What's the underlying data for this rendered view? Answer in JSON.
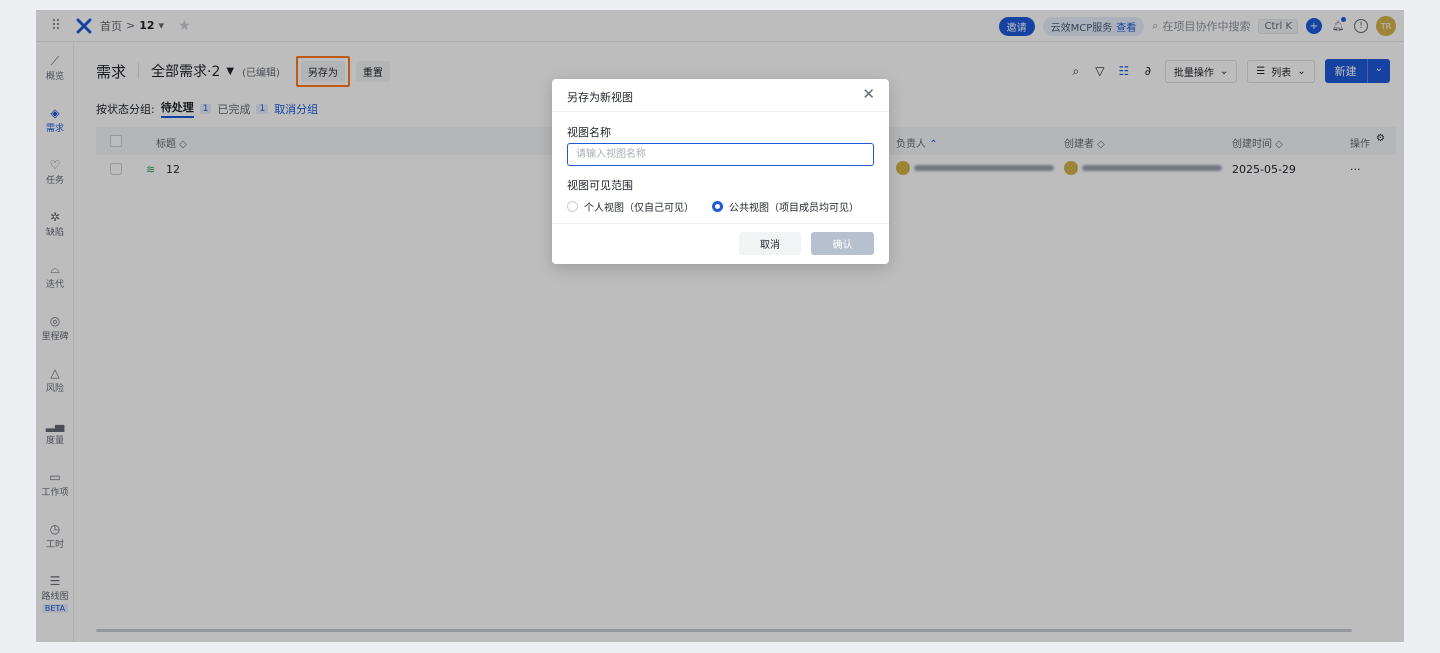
{
  "topbar": {
    "breadcrumb_home": "首页",
    "breadcrumb_sep": ">",
    "project": "12",
    "invite_label": "邀请",
    "mcp_label": "云效MCP服务",
    "mcp_view": "查看",
    "search_placeholder": "在项目协作中搜索",
    "shortcut": "Ctrl K",
    "avatar_initials": "TR"
  },
  "sidebar": {
    "items": [
      {
        "label": "概览",
        "icon": "chart-line-icon"
      },
      {
        "label": "需求",
        "icon": "layers-icon"
      },
      {
        "label": "任务",
        "icon": "lightbulb-icon"
      },
      {
        "label": "缺陷",
        "icon": "bug-icon"
      },
      {
        "label": "迭代",
        "icon": "iteration-icon"
      },
      {
        "label": "里程碑",
        "icon": "pin-icon"
      },
      {
        "label": "风险",
        "icon": "warning-icon"
      },
      {
        "label": "度量",
        "icon": "bars-icon"
      },
      {
        "label": "工作项",
        "icon": "folder-icon"
      },
      {
        "label": "工时",
        "icon": "clock-icon"
      },
      {
        "label": "路线图",
        "icon": "roadmap-icon"
      }
    ],
    "beta": "BETA"
  },
  "main": {
    "title": "需求",
    "view_name": "全部需求·2",
    "edited": "(已编辑)",
    "save_as": "另存为",
    "reset": "重置",
    "batch": "批量操作",
    "list": "列表",
    "new": "新建",
    "group_prefix": "按状态分组:",
    "group_pending": "待处理",
    "group_pending_count": "1",
    "group_done": "已完成",
    "group_done_count": "1",
    "group_cancel": "取消分组"
  },
  "table": {
    "headers": {
      "title": "标题",
      "assignee": "负责人",
      "creator": "创建者",
      "created": "创建时间",
      "actions": "操作"
    },
    "rows": [
      {
        "title": "12",
        "created": "2025-05-29",
        "more": "···"
      }
    ]
  },
  "modal": {
    "title": "另存为新视图",
    "name_label": "视图名称",
    "name_placeholder": "请输入视图名称",
    "name_value": "",
    "scope_label": "视图可见范围",
    "option_personal": "个人视图（仅自己可见）",
    "option_public": "公共视图（项目成员均可见）",
    "selected": "public",
    "cancel": "取消",
    "confirm": "确认"
  },
  "colors": {
    "accent": "#1e5bdb",
    "highlight_box": "#ff7a1a",
    "disabled_button": "#b7c0cf"
  }
}
